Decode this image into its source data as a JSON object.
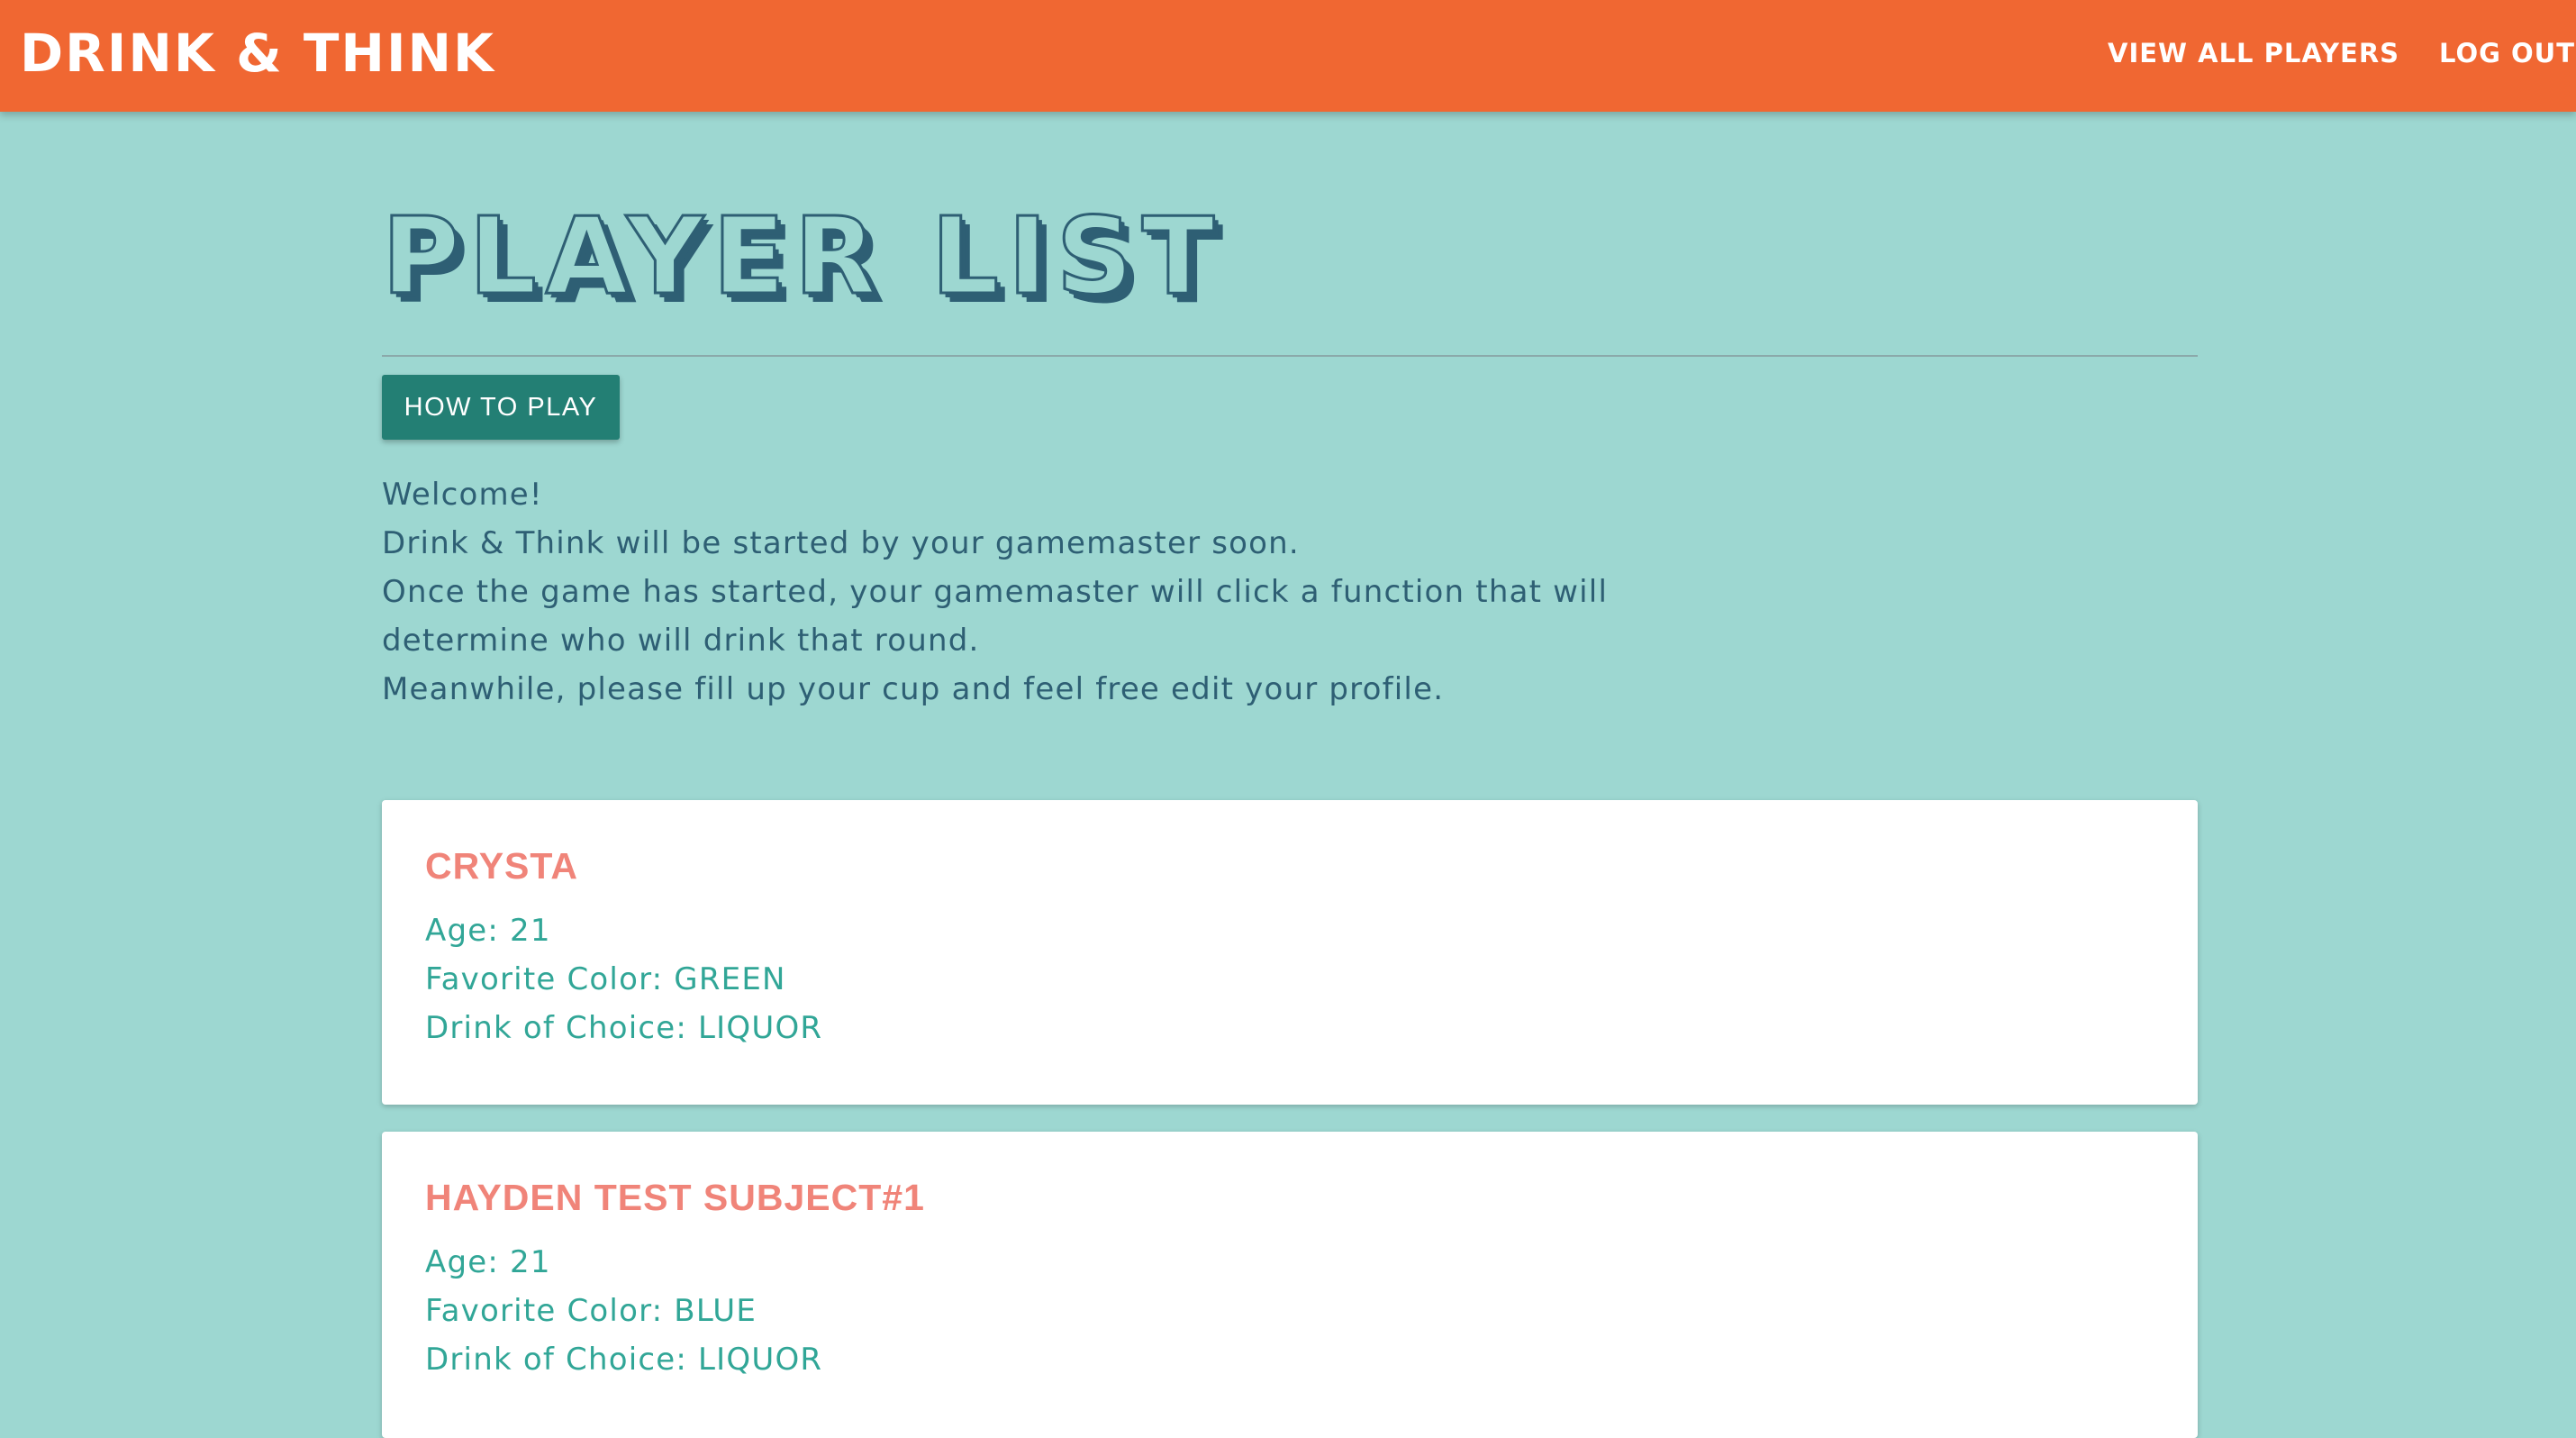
{
  "navbar": {
    "brand": "DRINK & THINK",
    "links": [
      "VIEW ALL PLAYERS",
      "LOG OUT"
    ]
  },
  "main": {
    "title": "PLAYER LIST",
    "how_to_play_label": "HOW TO PLAY",
    "welcome_lines": [
      "Welcome!",
      "Drink & Think will be started by your gamemaster soon.",
      "Once the game has started, your gamemaster will click a function that will",
      "determine who will drink that round.",
      "Meanwhile, please fill up your cup and feel free edit your profile."
    ]
  },
  "players": [
    {
      "name": "CRYSTA",
      "age": "Age: 21",
      "color": "Favorite Color: GREEN",
      "drink": "Drink of Choice: LIQUOR"
    },
    {
      "name": "HAYDEN TEST SUBJECT#1",
      "age": "Age: 21",
      "color": "Favorite Color: BLUE",
      "drink": "Drink of Choice: LIQUOR"
    }
  ],
  "colors": {
    "navbar": "#f06732",
    "background": "#9dd7d1",
    "title_outline": "#2e5f74",
    "button": "#237f74",
    "player_name": "#f08479",
    "player_info": "#31a697"
  }
}
